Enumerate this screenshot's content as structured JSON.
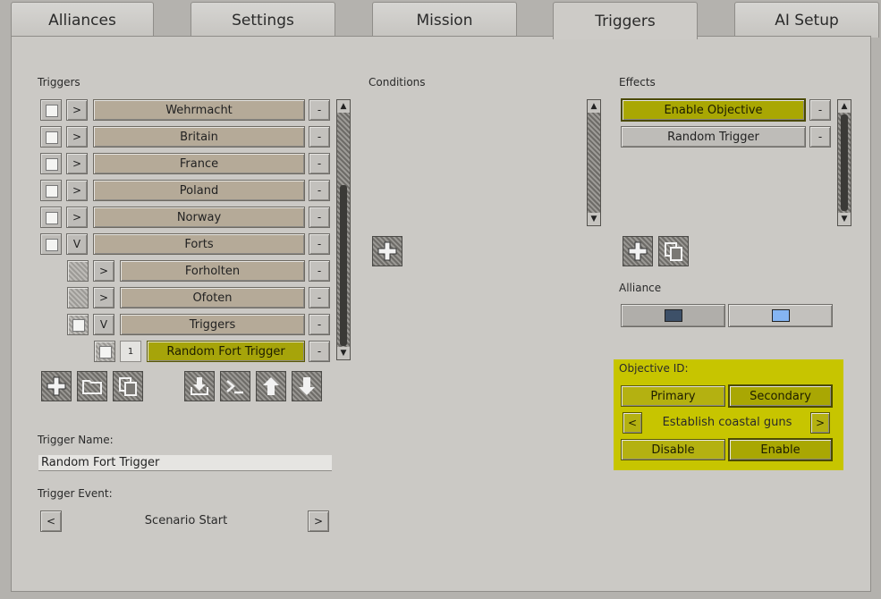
{
  "tabs": [
    "Alliances",
    "Settings",
    "Mission",
    "Triggers",
    "AI Setup"
  ],
  "active_tab": "Triggers",
  "triggers": {
    "label": "Triggers",
    "rows": [
      {
        "expander": ">",
        "name": "Wehrmacht"
      },
      {
        "expander": ">",
        "name": "Britain"
      },
      {
        "expander": ">",
        "name": "France"
      },
      {
        "expander": ">",
        "name": "Poland"
      },
      {
        "expander": ">",
        "name": "Norway"
      },
      {
        "expander": "V",
        "name": "Forts"
      },
      {
        "expander": ">",
        "name": "Forholten"
      },
      {
        "expander": ">",
        "name": "Ofoten"
      },
      {
        "expander": "V",
        "name": "Triggers"
      },
      {
        "expander": "1",
        "name": "Random Fort Trigger"
      }
    ],
    "remove_label": "-"
  },
  "conditions": {
    "label": "Conditions"
  },
  "effects": {
    "label": "Effects",
    "items": [
      "Enable Objective",
      "Random Trigger"
    ],
    "remove_label": "-"
  },
  "alliance": {
    "label": "Alliance",
    "colors": [
      "#3d5068",
      "#85b5f2"
    ]
  },
  "objective": {
    "label": "Objective ID:",
    "primary": "Primary",
    "secondary": "Secondary",
    "prev": "<",
    "value": "Establish coastal guns",
    "next": ">",
    "disable": "Disable",
    "enable": "Enable"
  },
  "trigger_name": {
    "label": "Trigger Name:",
    "value": "Random Fort Trigger"
  },
  "trigger_event": {
    "label": "Trigger Event:",
    "prev": "<",
    "value": "Scenario Start",
    "next": ">"
  },
  "scroll_arrows": {
    "up": "▲",
    "down": "▼"
  }
}
